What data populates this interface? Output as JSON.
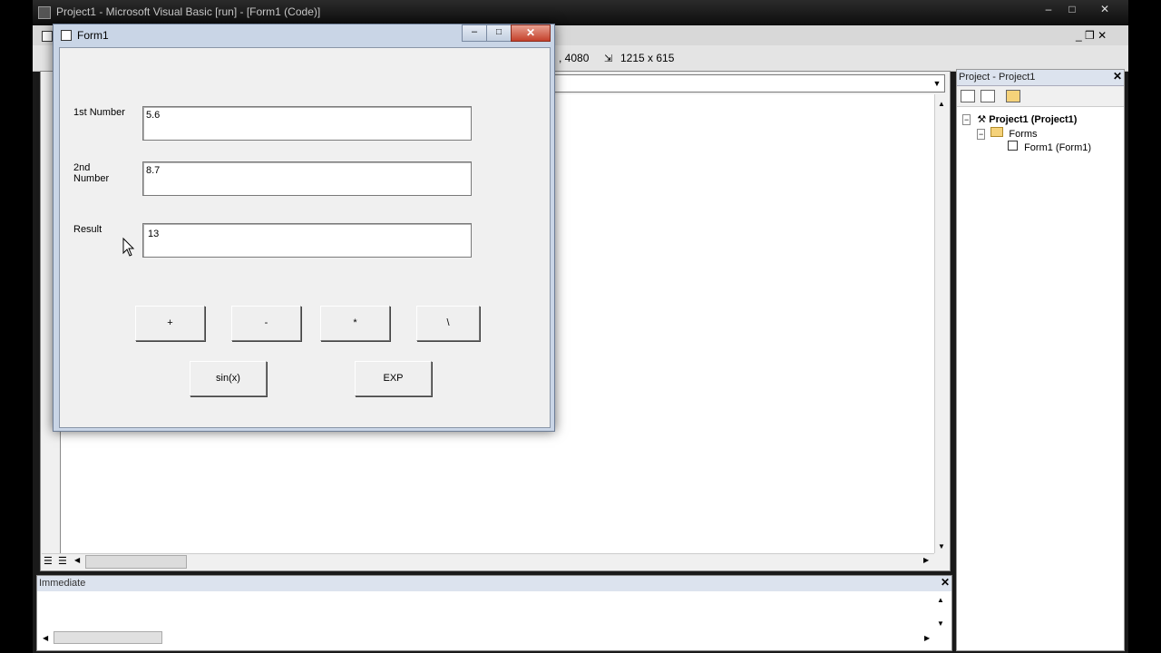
{
  "ide": {
    "title": "Project1 - Microsoft Visual Basic [run] - [Form1 (Code)]",
    "caption_buttons": [
      "–",
      "□",
      "✕"
    ],
    "mdi_buttons": "_ ❒ ✕",
    "position_readout": ", 4080",
    "size_readout": "1215 x 615"
  },
  "project": {
    "title": "Project - Project1",
    "close": "✕",
    "tree": [
      {
        "label": "Project1 (Project1)"
      },
      {
        "label": "Forms"
      },
      {
        "label": "Form1 (Form1)"
      }
    ]
  },
  "immediate": {
    "title": "Immediate",
    "close": "✕"
  },
  "form1": {
    "title": "Form1",
    "min": "–",
    "max": "□",
    "close": "✕",
    "labels": {
      "first": "1st  Number",
      "second_line1": "2nd",
      "second_line2": "Number",
      "result": "Result"
    },
    "fields": {
      "first": "5.6",
      "second": "8.7",
      "result": "13"
    },
    "buttons": {
      "add": "+",
      "subtract": "-",
      "multiply": "*",
      "int_divide": "\\",
      "sin": "sin(x)",
      "exp": "EXP"
    }
  }
}
